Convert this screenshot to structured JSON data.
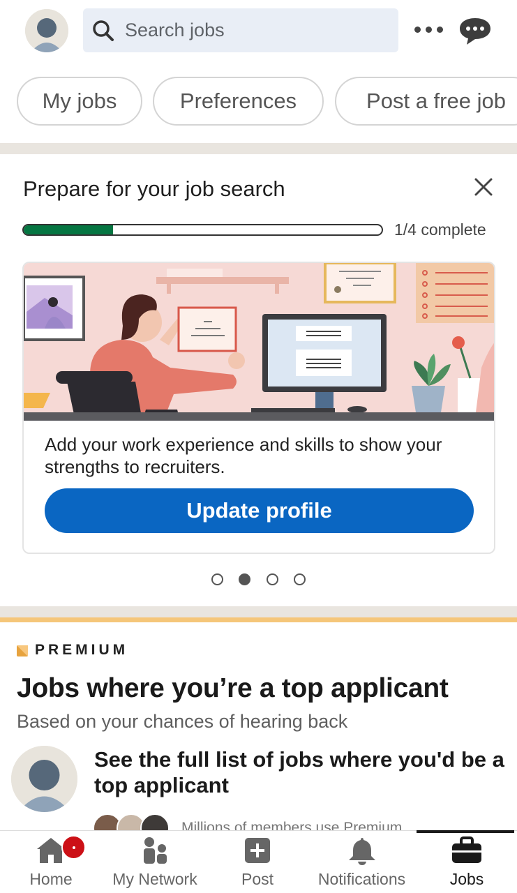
{
  "header": {
    "search_placeholder": "Search jobs",
    "icons": [
      "avatar",
      "search-icon",
      "more-icon",
      "messaging-icon"
    ]
  },
  "pills": [
    "My jobs",
    "Preferences",
    "Post a free job"
  ],
  "prepare": {
    "title": "Prepare for your job search",
    "progress_text": "1/4 complete",
    "progress_fraction": 0.25,
    "card_text": "Add your work experience and skills to show your strengths to recruiters.",
    "button_label": "Update profile",
    "carousel_active_index": 1,
    "carousel_count": 4
  },
  "premium": {
    "label": "PREMIUM",
    "heading": "Jobs where you’re a top applicant",
    "subheading": "Based on your chances of hearing back",
    "item_text": "See the full list of jobs where you'd be a top applicant",
    "members_text": "Millions of members use Premium"
  },
  "nav": {
    "items": [
      {
        "label": "Home",
        "icon": "home-icon"
      },
      {
        "label": "My Network",
        "icon": "network-icon"
      },
      {
        "label": "Post",
        "icon": "post-icon"
      },
      {
        "label": "Notifications",
        "icon": "bell-icon"
      },
      {
        "label": "Jobs",
        "icon": "briefcase-icon"
      }
    ],
    "active": "Jobs",
    "home_badge": "notification dot"
  },
  "colors": {
    "accent_blue": "#0a66c2",
    "progress_green": "#057642",
    "premium_gold": "#f5c679",
    "badge_red": "#cc1016"
  }
}
